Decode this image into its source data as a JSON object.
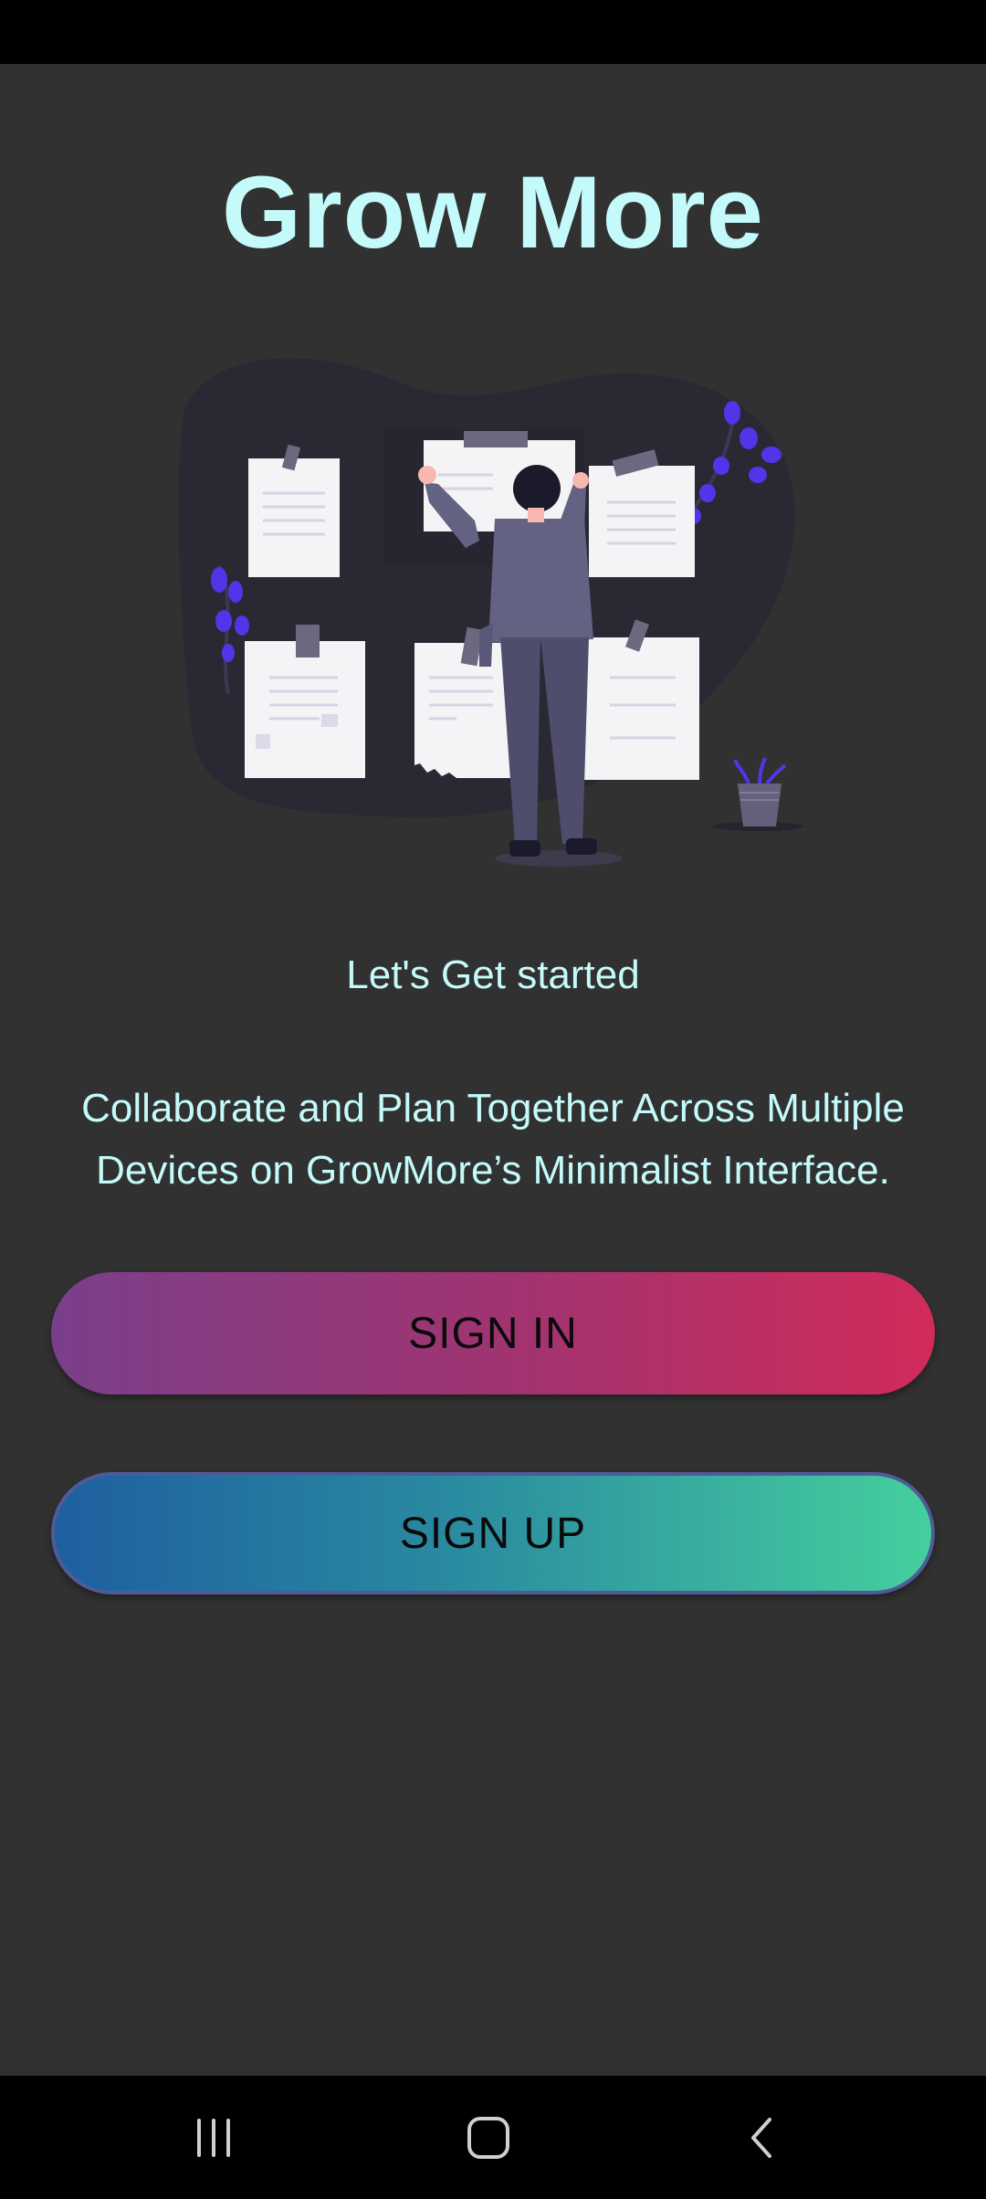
{
  "app": {
    "title": "Grow More"
  },
  "main": {
    "subtitle": "Let's Get started",
    "description": "Collaborate and Plan Together Across Multiple Devices on GrowMore’s Minimalist Interface.",
    "sign_in_label": "SIGN IN",
    "sign_up_label": "SIGN UP"
  },
  "navigation": {
    "recent_icon": "recent-apps-icon",
    "home_icon": "home-icon",
    "back_icon": "back-icon"
  },
  "colors": {
    "background": "#313131",
    "title": "#c4fafa",
    "sign_in_gradient": [
      "#7a3f8a",
      "#d12b5a"
    ],
    "sign_up_gradient": [
      "#1e5fa0",
      "#45cf9e"
    ],
    "illustration_accent": "#4e32e0"
  }
}
